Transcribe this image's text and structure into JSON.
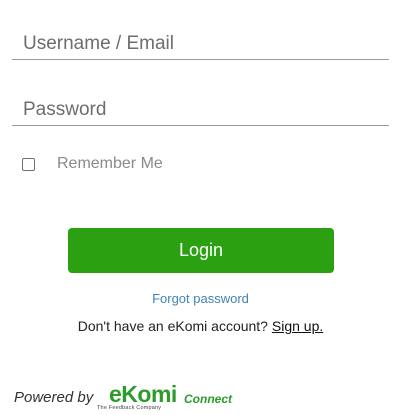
{
  "form": {
    "username_placeholder": "Username / Email",
    "password_placeholder": "Password",
    "remember_label": "Remember Me",
    "remember_checked": false,
    "login_label": "Login",
    "forgot_label": "Forgot password",
    "signup_prefix": "Don't have an eKomi account? ",
    "signup_link": "Sign up."
  },
  "footer": {
    "powered_by": "Powered by",
    "logo_main": "eKomi",
    "logo_sub": "Connect",
    "logo_tagline": "The Feedback Company"
  },
  "colors": {
    "accent": "#2ba111",
    "link": "#3f83b8",
    "logo": "#2a9c2a"
  }
}
